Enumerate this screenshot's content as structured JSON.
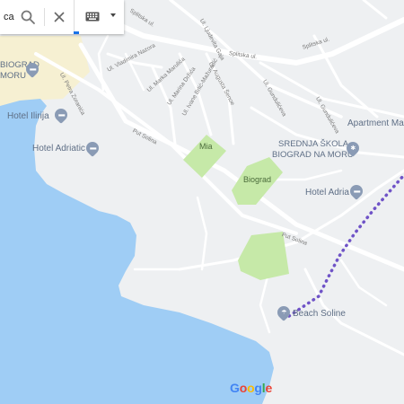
{
  "search": {
    "query_fragment": "ca",
    "search_icon": "search-icon",
    "clear_icon": "close-icon",
    "keyboard_icon": "keyboard-icon",
    "dropdown_icon": "chevron-down-icon"
  },
  "colors": {
    "water": "#9fcdf5",
    "land": "#eef0f2",
    "road": "#ffffff",
    "park": "#c6e9a8",
    "beach": "#f6f0d2",
    "route": "#6f53c7",
    "poi": "#8a9bb5"
  },
  "streets": {
    "splitska_1": "Splitska ul.",
    "ljudevita_gaja": "Ul. Ljudevita Gaja",
    "splitska_2": "Splitska ul.",
    "splitska_3": "Splitska ul.",
    "vladimira_nazora": "Ul. Vladimira Nazora",
    "augusta_senoe": "Ul. Augusta Šenoe",
    "gundulićeva_1": "Ul. Gundulićeva",
    "gundulićeva_2": "Ul. Gundulićeva",
    "petra_zoranica": "Ul. Petra Zoranića",
    "marka_marulica": "Ul. Marka Marulića",
    "marina_drzica": "Ul. Marina Držića",
    "ivana_brlic": "Ul. Ivane Brlić-Mažuranić",
    "put_solina_1": "Put Solina",
    "put_solina_2": "Put Solina"
  },
  "parks": {
    "mia": "Mia",
    "biograd": "Biograd"
  },
  "places": {
    "hotel_biograd_line1": "BIOGRAD",
    "hotel_biograd_line2": "MORU",
    "hotel_ilirija": "Hotel Ilirija",
    "hotel_adriatic": "Hotel Adriatic",
    "apartment": "Apartment Mas",
    "school_line1": "SREDNJA ŠKOLA",
    "school_line2": "BIOGRAD NA MORU",
    "hotel_adria": "Hotel Adria",
    "beach_soline": "Beach Soline"
  },
  "logo": {
    "google": [
      "G",
      "o",
      "o",
      "g",
      "l",
      "e"
    ]
  }
}
